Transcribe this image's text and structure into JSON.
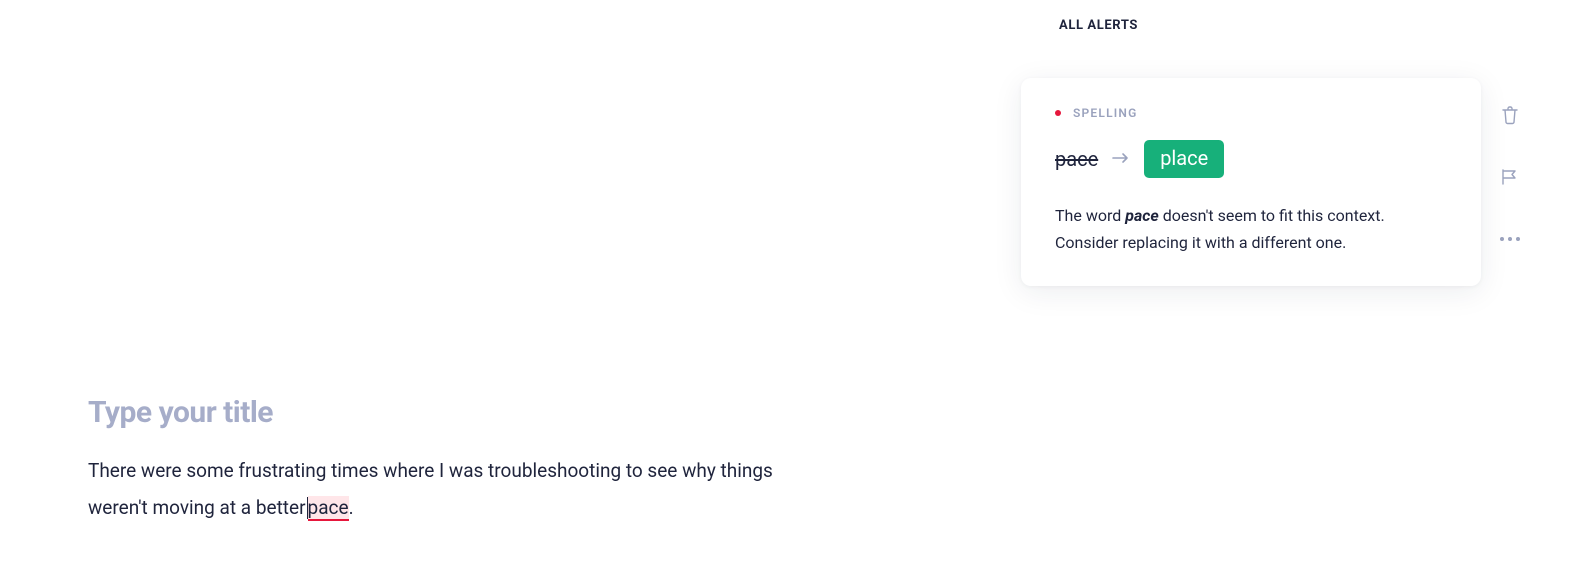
{
  "editor": {
    "title_placeholder": "Type your title",
    "body_before": "There were some frustrating times where I was troubleshooting to see why things weren't moving at a better",
    "flagged_word": "pace",
    "body_after": "."
  },
  "alerts": {
    "header": "ALL ALERTS",
    "card": {
      "category": "SPELLING",
      "dot_color": "#e6173c",
      "original": "pace",
      "suggestion": "place",
      "explain_before": "The word ",
      "explain_em": "pace",
      "explain_after": " doesn't seem to fit this context. Consider replacing it with a different one."
    }
  }
}
